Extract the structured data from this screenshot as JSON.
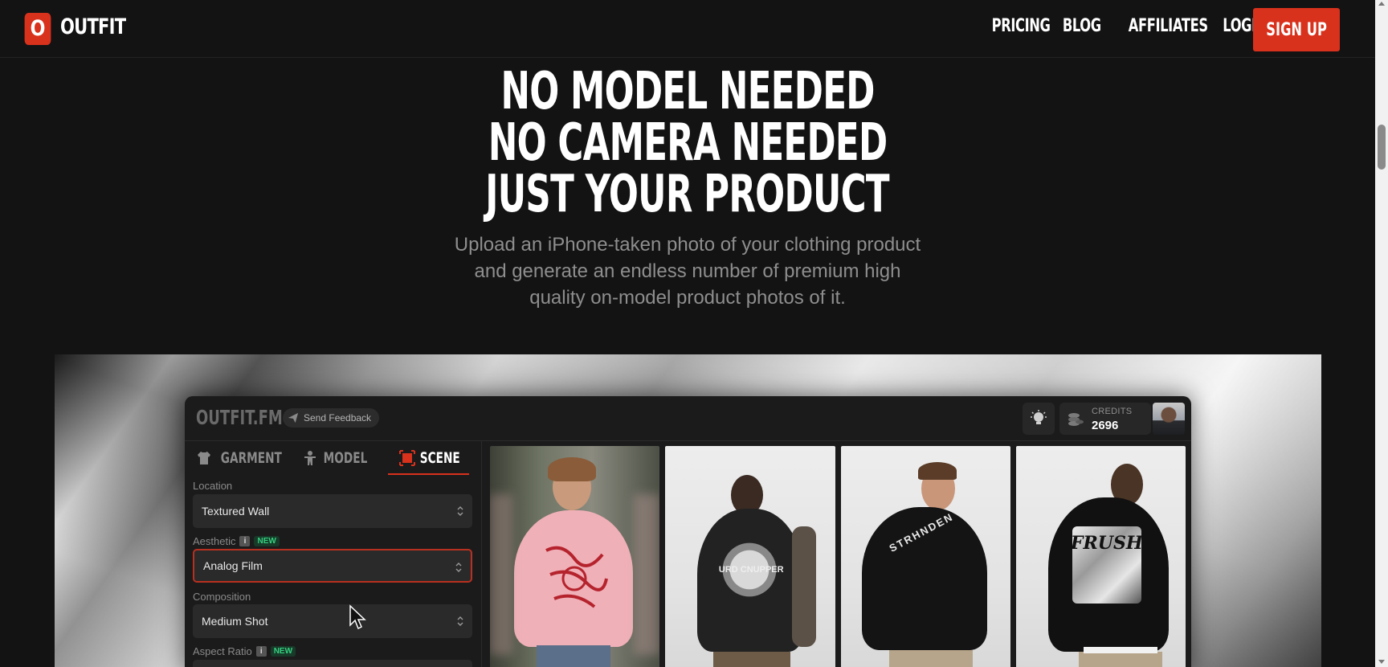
{
  "nav": {
    "logo_letter": "O",
    "logo_text": "OUTFIT",
    "links": [
      "PRICING",
      "BLOG",
      "AFFILIATES",
      "LOGIN"
    ],
    "signup": "SIGN UP",
    "accent_color": "#d8311c"
  },
  "hero": {
    "line1": "NO MODEL NEEDED",
    "line2": "NO CAMERA NEEDED",
    "line3": "JUST YOUR PRODUCT",
    "subtitle": "Upload an iPhone-taken photo of your clothing product and generate an endless number of premium high quality on-model product photos of it."
  },
  "app": {
    "logo": "OUTFIT.FM",
    "feedback": "Send Feedback",
    "credits_label": "CREDITS",
    "credits_value": "2696",
    "tabs": [
      {
        "label": "GARMENT",
        "icon": "shirt-icon"
      },
      {
        "label": "MODEL",
        "icon": "model-icon"
      },
      {
        "label": "SCENE",
        "icon": "scene-icon"
      }
    ],
    "active_tab": "SCENE",
    "fields": {
      "location_label": "Location",
      "location_value": "Textured Wall",
      "aesthetic_label": "Aesthetic",
      "aesthetic_value": "Analog Film",
      "composition_label": "Composition",
      "composition_value": "Medium Shot",
      "aspect_label": "Aspect Ratio",
      "new_badge": "NEW",
      "info_glyph": "i"
    },
    "photos": [
      {
        "name": "pink-hoodie-photo"
      },
      {
        "name": "black-hoodie-back-photo",
        "print_text": "URD CNUPPER"
      },
      {
        "name": "black-hoodie-turn-photo",
        "print_text": "STRHNDEN"
      },
      {
        "name": "black-hoodie-graphic-photo",
        "print_text": "FRUSH"
      }
    ]
  }
}
